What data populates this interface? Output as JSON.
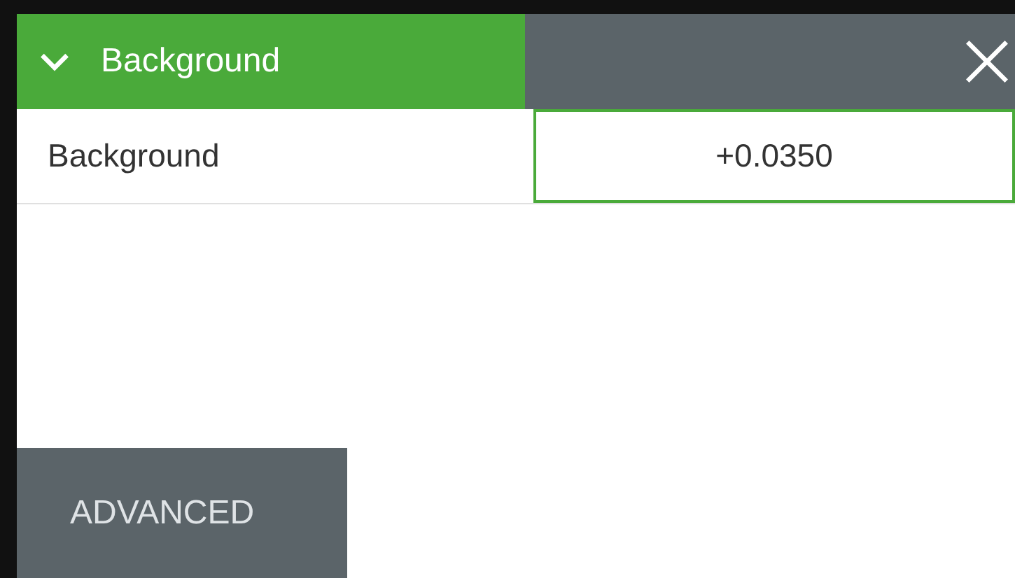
{
  "panel": {
    "title": "Background",
    "expanded": true
  },
  "rows": [
    {
      "label": "Background",
      "value": "+0.0350"
    }
  ],
  "buttons": [
    "ADVANCED"
  ]
}
